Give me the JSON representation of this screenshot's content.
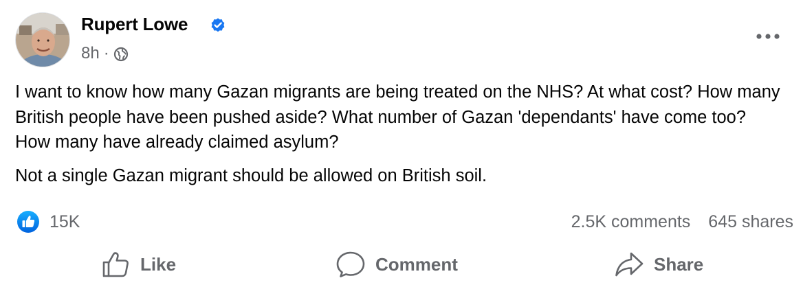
{
  "author": {
    "name": "Rupert Lowe",
    "verified": true
  },
  "meta": {
    "time": "8h",
    "separator": "·",
    "audience_icon": "globe-icon"
  },
  "post": {
    "paragraphs": [
      "I want to know how many Gazan migrants are being treated on the NHS? At what cost? How many British people have been pushed aside? What number of Gazan 'dependants' have come too? How many have already claimed asylum?",
      "Not a single Gazan migrant should be allowed on British soil."
    ]
  },
  "engagement": {
    "reaction_icon": "like-reaction-icon",
    "reaction_count": "15K",
    "comments": "2.5K comments",
    "shares": "645 shares"
  },
  "actions": {
    "like_label": "Like",
    "comment_label": "Comment",
    "share_label": "Share"
  },
  "colors": {
    "accent_blue": "#1877f2",
    "secondary_text": "#65676b",
    "primary_text": "#050505"
  }
}
